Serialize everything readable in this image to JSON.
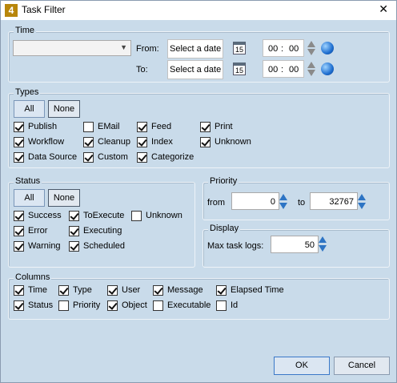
{
  "window": {
    "title": "Task Filter",
    "app_icon_text": "4",
    "close": "✕"
  },
  "time": {
    "label": "Time",
    "range_value": "",
    "from_label": "From:",
    "to_label": "To:",
    "from_date": "Select a date",
    "to_date": "Select a date",
    "calendar_day": "15",
    "from_hour": "00",
    "from_min": "00",
    "to_hour": "00",
    "to_min": "00",
    "separator": ":"
  },
  "types": {
    "label": "Types",
    "all": "All",
    "none": "None",
    "items": [
      {
        "label": "Publish",
        "checked": true
      },
      {
        "label": "EMail",
        "checked": false
      },
      {
        "label": "Feed",
        "checked": true
      },
      {
        "label": "Print",
        "checked": true
      },
      {
        "label": "Workflow",
        "checked": true
      },
      {
        "label": "Cleanup",
        "checked": true
      },
      {
        "label": "Index",
        "checked": true
      },
      {
        "label": "Unknown",
        "checked": true
      },
      {
        "label": "Data Source",
        "checked": true
      },
      {
        "label": "Custom",
        "checked": true
      },
      {
        "label": "Categorize",
        "checked": true
      }
    ]
  },
  "status": {
    "label": "Status",
    "all": "All",
    "none": "None",
    "items": [
      {
        "label": "Success",
        "checked": true
      },
      {
        "label": "ToExecute",
        "checked": true
      },
      {
        "label": "Unknown",
        "checked": false
      },
      {
        "label": "Error",
        "checked": true
      },
      {
        "label": "Executing",
        "checked": true
      },
      {
        "label": "Warning",
        "checked": true
      },
      {
        "label": "Scheduled",
        "checked": true
      }
    ]
  },
  "priority": {
    "label": "Priority",
    "from_label": "from",
    "from_value": "0",
    "to_label": "to",
    "to_value": "32767"
  },
  "display": {
    "label": "Display",
    "max_logs_label": "Max task logs:",
    "max_logs_value": "50"
  },
  "columns": {
    "label": "Columns",
    "items": [
      {
        "label": "Time",
        "checked": true
      },
      {
        "label": "Type",
        "checked": true
      },
      {
        "label": "User",
        "checked": true
      },
      {
        "label": "Message",
        "checked": true
      },
      {
        "label": "Elapsed Time",
        "checked": true
      },
      {
        "label": "Status",
        "checked": true
      },
      {
        "label": "Priority",
        "checked": false
      },
      {
        "label": "Object",
        "checked": true
      },
      {
        "label": "Executable",
        "checked": false
      },
      {
        "label": "Id",
        "checked": false
      }
    ]
  },
  "buttons": {
    "ok": "OK",
    "cancel": "Cancel"
  }
}
